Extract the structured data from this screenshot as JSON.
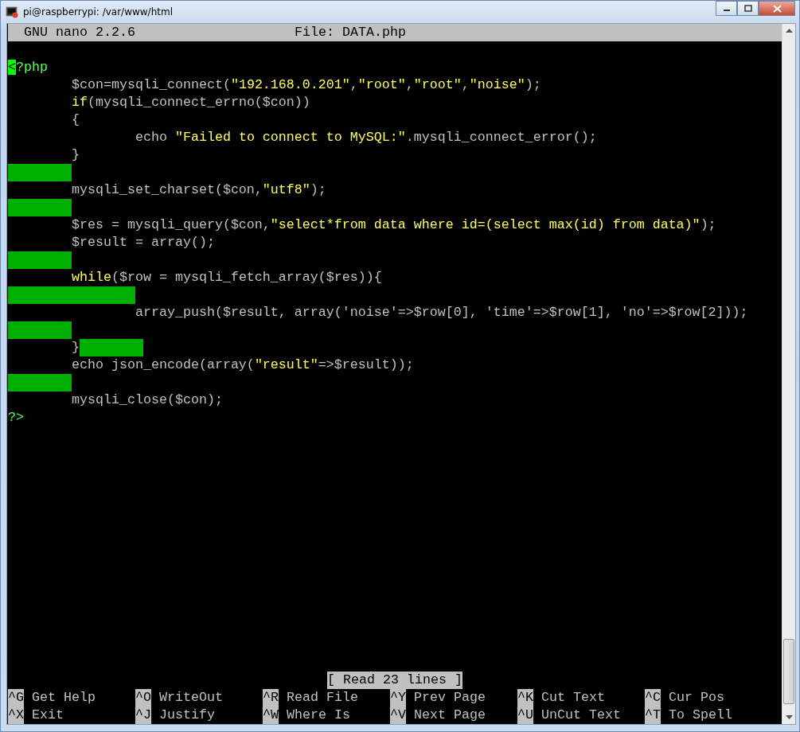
{
  "window": {
    "title": "pi@raspberrypi: /var/www/html"
  },
  "header": {
    "version": "GNU nano 2.2.6",
    "file": "File: DATA.php"
  },
  "lines": [
    {
      "indented": false,
      "nested": false,
      "trailing_whitespace": false,
      "segments": [
        {
          "kind": "cursor",
          "text": "<"
        },
        {
          "kind": "tag",
          "text": "?php"
        }
      ]
    },
    {
      "indented": true,
      "nested": false,
      "trailing_whitespace": false,
      "segments": [
        {
          "kind": "plain",
          "text": "$con=mysqli_connect("
        },
        {
          "kind": "string",
          "text": "\"192.168.0.201\""
        },
        {
          "kind": "plain",
          "text": ","
        },
        {
          "kind": "string",
          "text": "\"root\""
        },
        {
          "kind": "plain",
          "text": ","
        },
        {
          "kind": "string",
          "text": "\"root\""
        },
        {
          "kind": "plain",
          "text": ","
        },
        {
          "kind": "string",
          "text": "\"noise\""
        },
        {
          "kind": "plain",
          "text": ");"
        }
      ]
    },
    {
      "indented": true,
      "nested": false,
      "trailing_whitespace": false,
      "segments": [
        {
          "kind": "keyword",
          "text": "if"
        },
        {
          "kind": "plain",
          "text": "(mysqli_connect_errno($con))"
        }
      ]
    },
    {
      "indented": true,
      "nested": false,
      "trailing_whitespace": false,
      "segments": [
        {
          "kind": "plain",
          "text": "{"
        }
      ]
    },
    {
      "indented": true,
      "nested": true,
      "trailing_whitespace": false,
      "segments": [
        {
          "kind": "plain",
          "text": "echo "
        },
        {
          "kind": "string",
          "text": "\"Failed to connect to MySQL:\""
        },
        {
          "kind": "plain",
          "text": ".mysqli_connect_error();"
        }
      ]
    },
    {
      "indented": true,
      "nested": false,
      "trailing_whitespace": false,
      "segments": [
        {
          "kind": "plain",
          "text": "}"
        }
      ]
    },
    {
      "indented": true,
      "nested": false,
      "trailing_whitespace": true
    },
    {
      "indented": true,
      "nested": false,
      "trailing_whitespace": false,
      "segments": [
        {
          "kind": "plain",
          "text": "mysqli_set_charset($con,"
        },
        {
          "kind": "string",
          "text": "\"utf8\""
        },
        {
          "kind": "plain",
          "text": ");"
        }
      ]
    },
    {
      "indented": true,
      "nested": false,
      "trailing_whitespace": true
    },
    {
      "indented": true,
      "nested": false,
      "trailing_whitespace": false,
      "segments": [
        {
          "kind": "plain",
          "text": "$res = mysqli_query($con,"
        },
        {
          "kind": "string",
          "text": "\"select*from data where id=(select max(id) from data)\""
        },
        {
          "kind": "plain",
          "text": ");"
        }
      ]
    },
    {
      "indented": true,
      "nested": false,
      "trailing_whitespace": false,
      "segments": [
        {
          "kind": "plain",
          "text": "$result = array();"
        }
      ]
    },
    {
      "indented": true,
      "nested": false,
      "trailing_whitespace": true
    },
    {
      "indented": true,
      "nested": false,
      "trailing_whitespace": false,
      "segments": [
        {
          "kind": "keyword",
          "text": "while"
        },
        {
          "kind": "plain",
          "text": "($row = mysqli_fetch_array($res)){"
        }
      ]
    },
    {
      "indented": true,
      "nested": true,
      "trailing_whitespace": true
    },
    {
      "indented": true,
      "nested": true,
      "trailing_whitespace": false,
      "segments": [
        {
          "kind": "plain",
          "text": "array_push($result, array('noise'=>$row[0], 'time'=>$row[1], 'no'=>$row[2]));"
        }
      ]
    },
    {
      "indented": true,
      "nested": false,
      "trailing_whitespace": true
    },
    {
      "indented": true,
      "nested": false,
      "trailing_whitespace": true,
      "segments": [
        {
          "kind": "plain",
          "text": "}"
        }
      ]
    },
    {
      "indented": true,
      "nested": false,
      "trailing_whitespace": false,
      "segments": [
        {
          "kind": "plain",
          "text": "echo json_encode(array("
        },
        {
          "kind": "string",
          "text": "\"result\""
        },
        {
          "kind": "plain",
          "text": "=>$result));"
        }
      ]
    },
    {
      "indented": true,
      "nested": false,
      "trailing_whitespace": true
    },
    {
      "indented": true,
      "nested": false,
      "trailing_whitespace": false,
      "segments": [
        {
          "kind": "plain",
          "text": "mysqli_close($con);"
        }
      ]
    },
    {
      "indented": false,
      "nested": false,
      "trailing_whitespace": false,
      "segments": [
        {
          "kind": "tag",
          "text": "?>"
        }
      ]
    }
  ],
  "status": "[ Read 23 lines ]",
  "shortcuts": [
    [
      {
        "key": "^G",
        "label": "Get Help"
      },
      {
        "key": "^O",
        "label": "WriteOut"
      },
      {
        "key": "^R",
        "label": "Read File"
      },
      {
        "key": "^Y",
        "label": "Prev Page"
      },
      {
        "key": "^K",
        "label": "Cut Text"
      },
      {
        "key": "^C",
        "label": "Cur Pos"
      }
    ],
    [
      {
        "key": "^X",
        "label": "Exit"
      },
      {
        "key": "^J",
        "label": "Justify"
      },
      {
        "key": "^W",
        "label": "Where Is"
      },
      {
        "key": "^V",
        "label": "Next Page"
      },
      {
        "key": "^U",
        "label": "UnCut Text"
      },
      {
        "key": "^T",
        "label": "To Spell"
      }
    ]
  ]
}
